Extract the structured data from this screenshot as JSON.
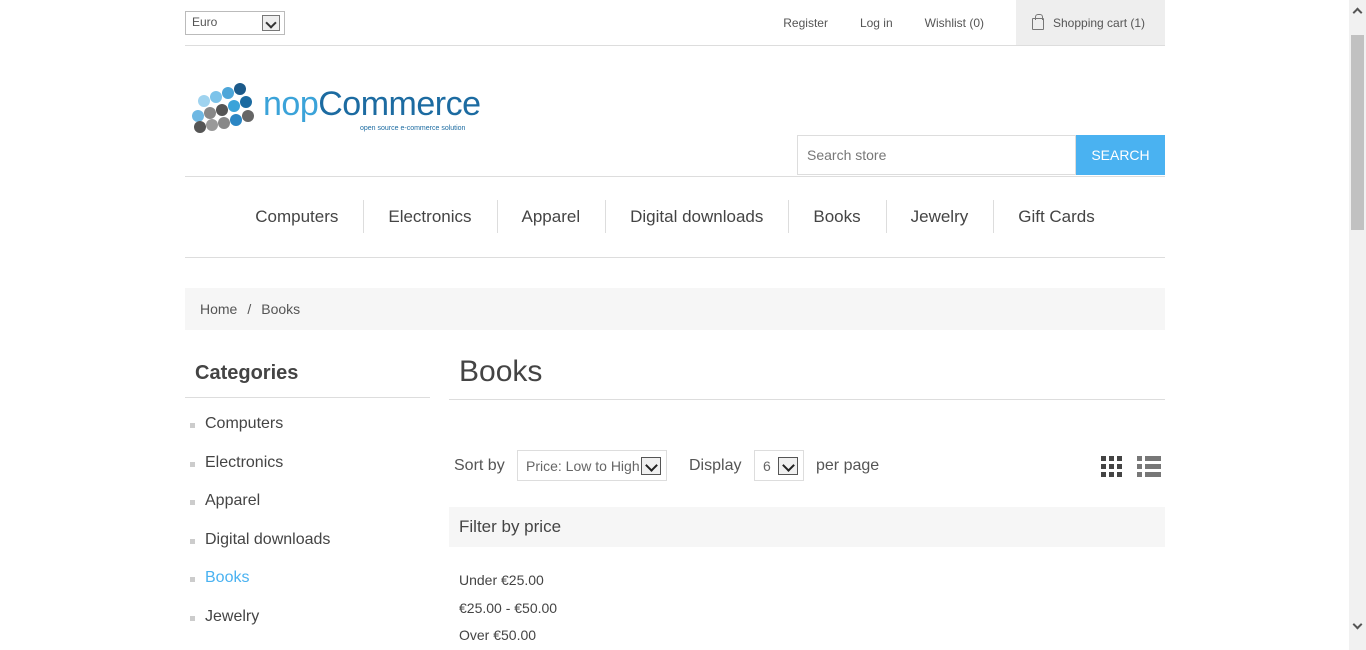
{
  "header": {
    "currency": "Euro",
    "links": {
      "register": "Register",
      "login": "Log in",
      "wishlist": "Wishlist (0)",
      "cart": "Shopping cart (1)"
    }
  },
  "logo": {
    "brand_prefix": "nop",
    "brand_suffix": "Commerce",
    "tagline": "open source e-commerce solution"
  },
  "search": {
    "placeholder": "Search store",
    "button": "SEARCH"
  },
  "menu": [
    "Computers",
    "Electronics",
    "Apparel",
    "Digital downloads",
    "Books",
    "Jewelry",
    "Gift Cards"
  ],
  "breadcrumb": {
    "home": "Home",
    "separator": "/",
    "current": "Books"
  },
  "sidebar": {
    "title": "Categories",
    "items": [
      {
        "label": "Computers",
        "active": false
      },
      {
        "label": "Electronics",
        "active": false
      },
      {
        "label": "Apparel",
        "active": false
      },
      {
        "label": "Digital downloads",
        "active": false
      },
      {
        "label": "Books",
        "active": true
      },
      {
        "label": "Jewelry",
        "active": false
      }
    ]
  },
  "main": {
    "title": "Books",
    "sort_label": "Sort by",
    "sort_value": "Price: Low to High",
    "display_label": "Display",
    "display_value": "6",
    "per_page_label": "per page",
    "filter_title": "Filter by price",
    "price_ranges": [
      "Under €25.00",
      "€25.00 - €50.00",
      "Over €50.00"
    ]
  },
  "colors": {
    "accent": "#4ab2f1",
    "active_link": "#4ab2f1",
    "panel_bg": "#f6f6f6"
  }
}
